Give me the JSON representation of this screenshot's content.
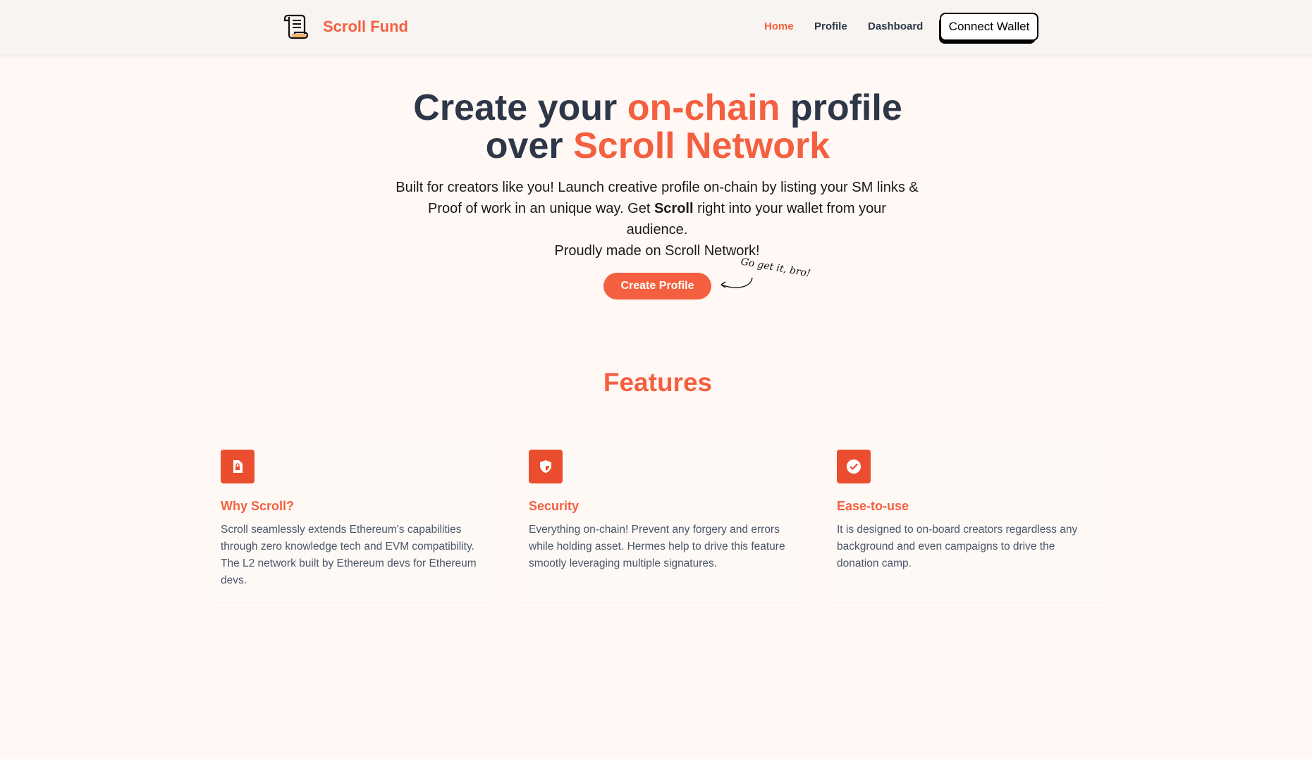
{
  "nav": {
    "brand": "Scroll Fund",
    "links": [
      "Home",
      "Profile",
      "Dashboard"
    ],
    "connect_wallet": "Connect Wallet"
  },
  "hero": {
    "title_1": "Create your ",
    "title_2": "on-chain",
    "title_3": " profile",
    "title_4": "over ",
    "title_5": "Scroll Network",
    "sub_1": "Built for creators like you! Launch creative profile on-chain by listing your SM links & Proof of work in an unique way. Get ",
    "sub_bold": "Scroll",
    "sub_2": " right into your wallet from your audience.",
    "sub_3": "Proudly made on Scroll Network!",
    "cta": "Create Profile",
    "hint": "Go get it, bro!"
  },
  "features": {
    "title": "Features",
    "cards": [
      {
        "icon": "file-lock-icon",
        "title": "Why Scroll?",
        "text": "Scroll seamlessly extends Ethereum's capabilities through zero knowledge tech and EVM compatibility. The L2 network built by Ethereum devs for Ethereum devs."
      },
      {
        "icon": "shield-icon",
        "title": "Security",
        "text": "Everything on-chain! Prevent any forgery and errors while holding asset. Hermes help to drive this feature smootly leveraging multiple signatures."
      },
      {
        "icon": "check-circle-icon",
        "title": "Ease-to-use",
        "text": "It is designed to on-board creators regardless any background and even campaigns to drive the donation camp."
      }
    ]
  },
  "colors": {
    "accent": "#f4603f",
    "icon_bg": "#ea4e2f",
    "page_bg": "#fff8f5"
  }
}
